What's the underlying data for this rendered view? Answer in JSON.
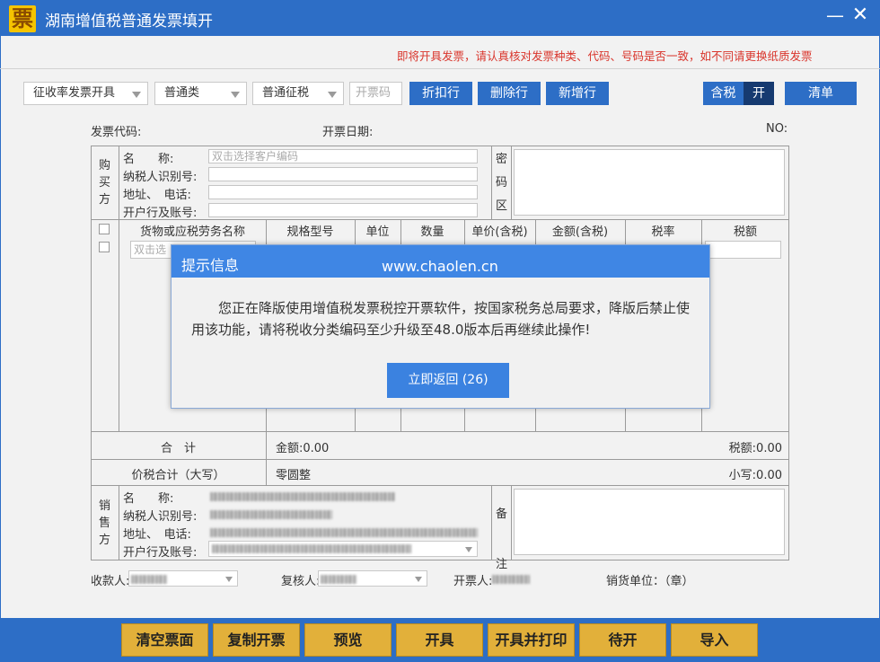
{
  "app": {
    "logo_char": "票",
    "title": "湖南增值税普通发票填开"
  },
  "window": {
    "minimize_glyph": "—",
    "close_glyph": "✕"
  },
  "warning": "即将开具发票，请认真核对发票种类、代码、号码是否一致，如不同请更换纸质发票",
  "toolbar": {
    "mode_select": "征收率发票开具",
    "category_select": "普通类",
    "tax_select": "普通征税",
    "code_placeholder": "开票码",
    "discount_btn": "折扣行",
    "delete_btn": "删除行",
    "add_btn": "新增行",
    "tax_incl_label": "含税",
    "tax_toggle": "开",
    "list_btn": "清单"
  },
  "invoice": {
    "code_label": "发票代码:",
    "date_label": "开票日期:",
    "no_label": "NO:",
    "buyer": {
      "section_chars": [
        "购",
        "买",
        "方"
      ],
      "name_label": "名　　称:",
      "name_placeholder": "双击选择客户编码",
      "taxid_label": "纳税人识别号:",
      "addr_label": "地址、　电话:",
      "bank_label": "开户行及账号:",
      "pwd_chars": [
        "密",
        "码",
        "区"
      ]
    },
    "items": {
      "headers": [
        "货物或应税劳务名称",
        "规格型号",
        "单位",
        "数量",
        "单价(含税)",
        "金额(含税)",
        "税率",
        "税额"
      ],
      "first_row_placeholder": "双击选"
    },
    "total": {
      "label": "合　计",
      "amount": "金额:0.00",
      "tax": "税额:0.00"
    },
    "grand": {
      "label": "价税合计（大写）",
      "uppercase": "零圆整",
      "lowercase": "小写:0.00"
    },
    "seller": {
      "section_chars": [
        "销",
        "售",
        "方"
      ],
      "name_label": "名　　称:",
      "taxid_label": "纳税人识别号:",
      "addr_label": "地址、　电话:",
      "bank_label": "开户行及账号:",
      "remark_chars": [
        "备",
        "注"
      ]
    },
    "footer": {
      "payee_label": "收款人:",
      "reviewer_label": "复核人:",
      "issuer_label": "开票人:",
      "seller_unit": "销货单位：（章）"
    }
  },
  "dialog": {
    "title": "提示信息",
    "watermark": "www.chaolen.cn",
    "message": "您正在降版使用增值税发票税控开票软件，按国家税务总局要求，降版后禁止使用该功能，请将税收分类编码至少升级至48.0版本后再继续此操作!",
    "button": "立即返回 (26)"
  },
  "bottom_buttons": [
    "清空票面",
    "复制开票",
    "预览",
    "开具",
    "开具并打印",
    "待开",
    "导入"
  ],
  "colors": {
    "title_bar": "#2d6ec6",
    "warning_text": "#d9352c",
    "button_gold": "#e2b03a",
    "dialog_header": "#3f86e4"
  }
}
